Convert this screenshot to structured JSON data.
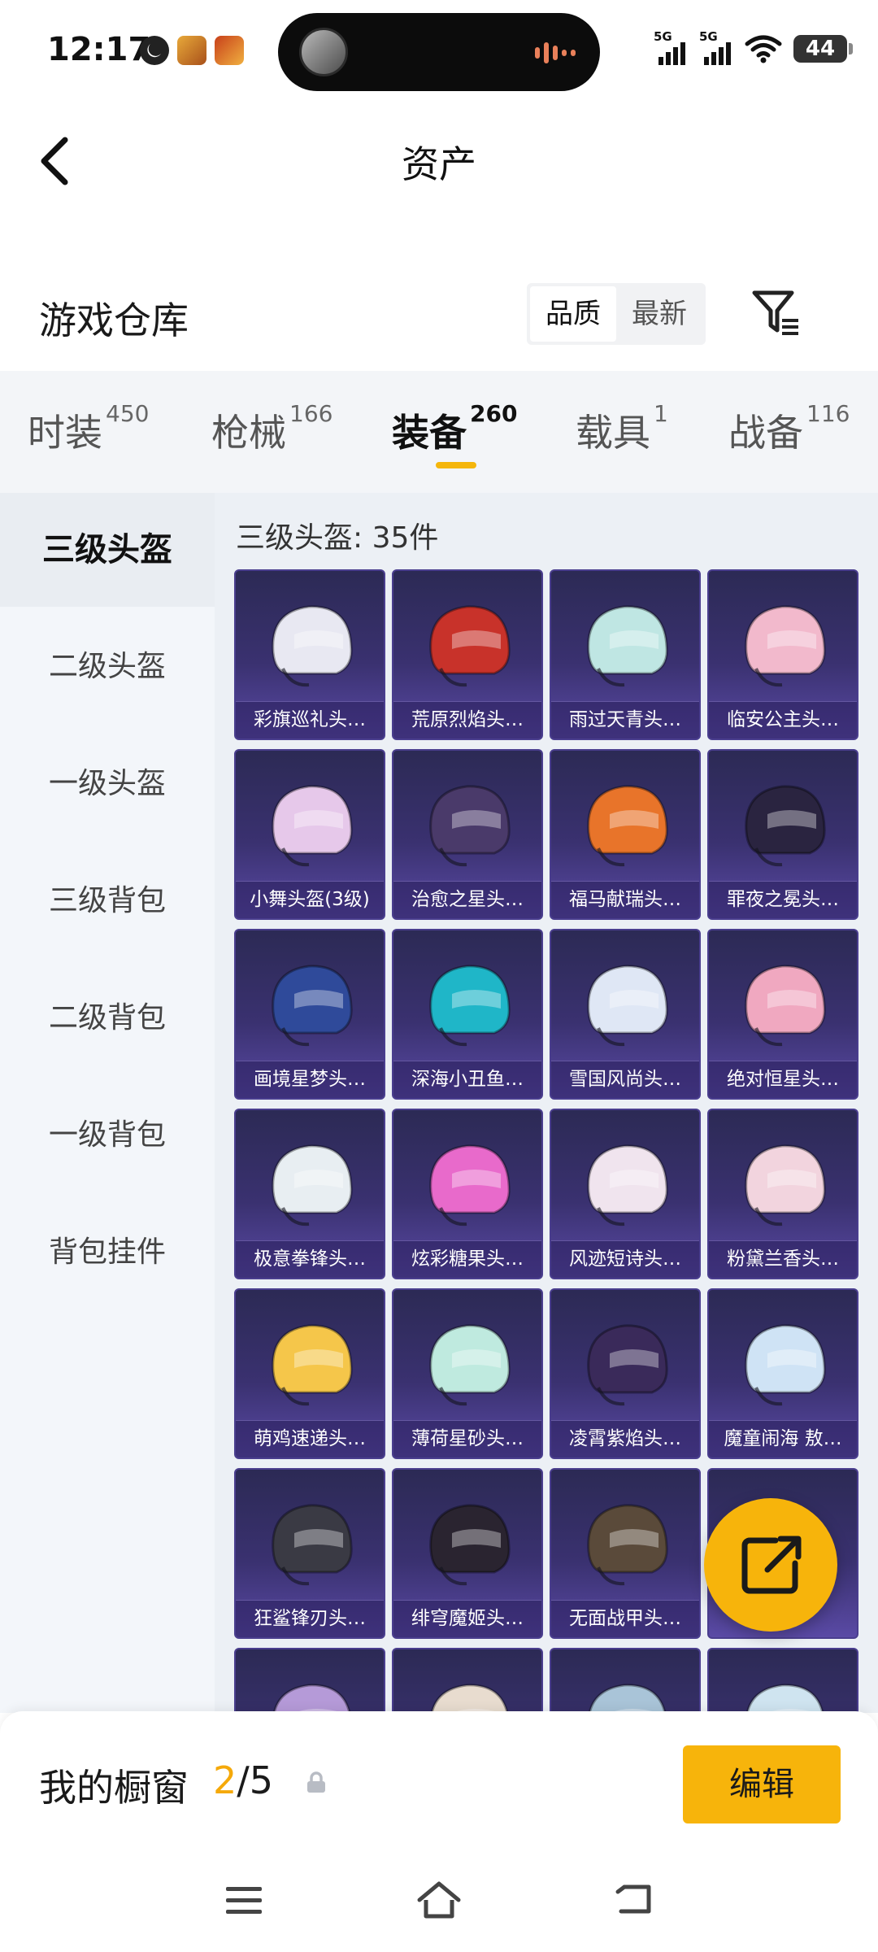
{
  "status_bar": {
    "time": "12:17",
    "battery": "44",
    "signal_1": "5G",
    "signal_2": "5G"
  },
  "header": {
    "title": "资产"
  },
  "section": {
    "title": "游戏仓库",
    "sort_options": [
      "品质",
      "最新"
    ],
    "active_sort": "品质"
  },
  "tabs": [
    {
      "label": "时装",
      "count": "450"
    },
    {
      "label": "枪械",
      "count": "166"
    },
    {
      "label": "装备",
      "count": "260"
    },
    {
      "label": "载具",
      "count": "1"
    },
    {
      "label": "战备",
      "count": "116"
    }
  ],
  "active_tab": "装备",
  "sidebar": {
    "items": [
      {
        "label": "三级头盔"
      },
      {
        "label": "二级头盔"
      },
      {
        "label": "一级头盔"
      },
      {
        "label": "三级背包"
      },
      {
        "label": "二级背包"
      },
      {
        "label": "一级背包"
      },
      {
        "label": "背包挂件"
      }
    ],
    "active": "三级头盔"
  },
  "content": {
    "header": "三级头盔: 35件",
    "items": [
      {
        "label": "彩旗巡礼头…",
        "color": "#e8e8f2"
      },
      {
        "label": "荒原烈焰头…",
        "color": "#c8322a"
      },
      {
        "label": "雨过天青头…",
        "color": "#bfe6e3"
      },
      {
        "label": "临安公主头…",
        "color": "#f2b9cc"
      },
      {
        "label": "小舞头盔(3级)",
        "color": "#e6c8ea"
      },
      {
        "label": "治愈之星头…",
        "color": "#4a3a6a"
      },
      {
        "label": "福马献瑞头…",
        "color": "#e8742a"
      },
      {
        "label": "罪夜之冕头…",
        "color": "#2a2440"
      },
      {
        "label": "画境星梦头…",
        "color": "#2f4a9a"
      },
      {
        "label": "深海小丑鱼…",
        "color": "#1fb6c8"
      },
      {
        "label": "雪国风尚头…",
        "color": "#dfe7f5"
      },
      {
        "label": "绝对恒星头…",
        "color": "#f0a8c0"
      },
      {
        "label": "极意拳锋头…",
        "color": "#e8eef2"
      },
      {
        "label": "炫彩糖果头…",
        "color": "#e86acb"
      },
      {
        "label": "风迹短诗头…",
        "color": "#f0e4ee"
      },
      {
        "label": "粉黛兰香头…",
        "color": "#f2d4de"
      },
      {
        "label": "萌鸡速递头…",
        "color": "#f5c64a"
      },
      {
        "label": "薄荷星砂头…",
        "color": "#bfeadf"
      },
      {
        "label": "凌霄紫焰头…",
        "color": "#3a2a5a"
      },
      {
        "label": "魔童闹海 敖…",
        "color": "#cfe3f5"
      },
      {
        "label": "狂鲨锋刃头…",
        "color": "#3a3a44"
      },
      {
        "label": "绯穹魔姬头…",
        "color": "#2a2430"
      },
      {
        "label": "无面战甲头…",
        "color": "#5a4a3a"
      },
      {
        "label": "",
        "color": "#eaf2ff"
      },
      {
        "label": "",
        "color": "#b59ad8"
      },
      {
        "label": "",
        "color": "#e8dccf"
      },
      {
        "label": "",
        "color": "#a9c4d8"
      },
      {
        "label": "",
        "color": "#cfe4f0"
      }
    ]
  },
  "showcase": {
    "title": "我的橱窗",
    "current": "2",
    "total": "/5",
    "edit_label": "编辑"
  },
  "colors": {
    "accent": "#f7b40b",
    "card_bg": "#3a3170"
  }
}
